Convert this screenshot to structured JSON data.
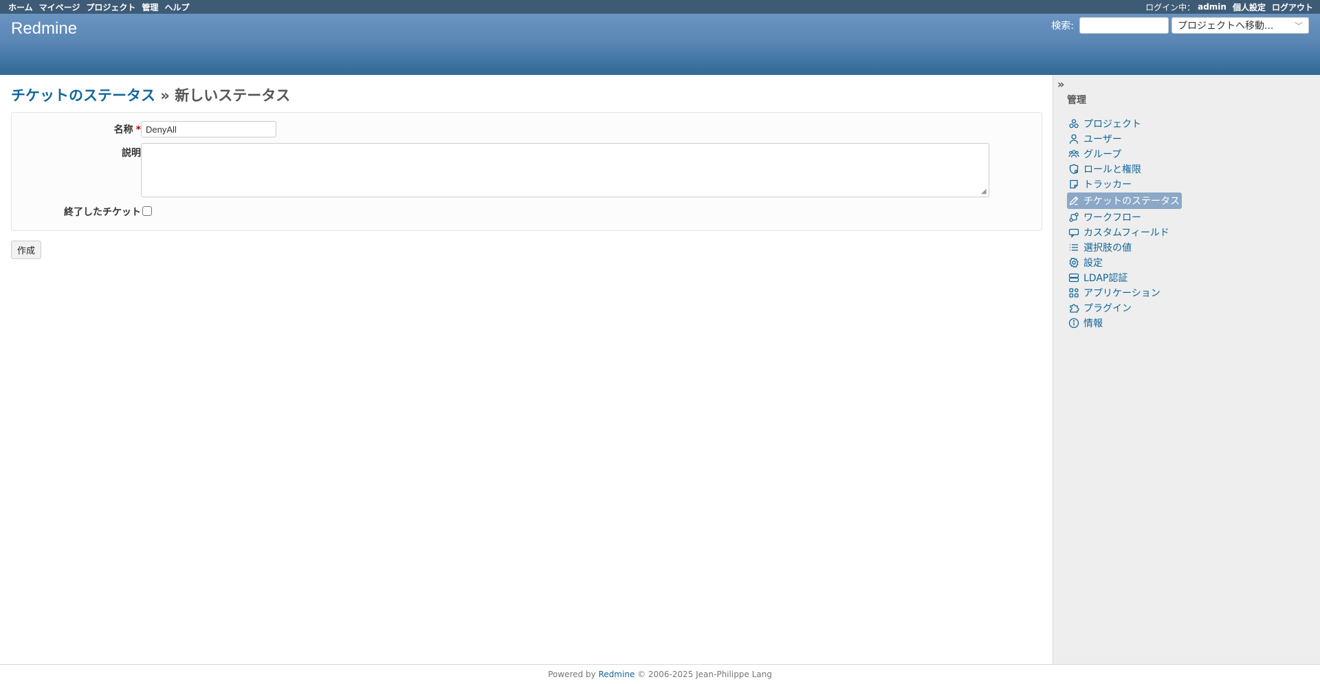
{
  "top_menu": {
    "items": [
      "ホーム",
      "マイページ",
      "プロジェクト",
      "管理",
      "ヘルプ"
    ],
    "logged_in_label": "ログイン中：",
    "user": "admin",
    "my_account": "個人設定",
    "logout": "ログアウト"
  },
  "header": {
    "title": "Redmine",
    "search_label": "検索:",
    "search_value": "",
    "jump_label": "プロジェクトへ移動..."
  },
  "page": {
    "breadcrumb_link": "チケットのステータス",
    "breadcrumb_sep": " » ",
    "breadcrumb_current": "新しいステータス"
  },
  "form": {
    "name_label": "名称",
    "required_mark": "*",
    "name_value": "DenyAll",
    "description_label": "説明",
    "description_value": "",
    "closed_label": "終了したチケット",
    "closed_checked": false,
    "submit_label": "作成"
  },
  "sidebar": {
    "title": "管理",
    "items": [
      {
        "label": "プロジェクト",
        "icon": "projects-icon"
      },
      {
        "label": "ユーザー",
        "icon": "user-icon"
      },
      {
        "label": "グループ",
        "icon": "group-icon"
      },
      {
        "label": "ロールと権限",
        "icon": "roles-icon"
      },
      {
        "label": "トラッカー",
        "icon": "tracker-icon"
      },
      {
        "label": "チケットのステータス",
        "icon": "issue-status-icon",
        "selected": true
      },
      {
        "label": "ワークフロー",
        "icon": "workflow-icon"
      },
      {
        "label": "カスタムフィールド",
        "icon": "custom-field-icon"
      },
      {
        "label": "選択肢の値",
        "icon": "list-icon"
      },
      {
        "label": "設定",
        "icon": "gear-icon"
      },
      {
        "label": "LDAP認証",
        "icon": "server-icon"
      },
      {
        "label": "アプリケーション",
        "icon": "apps-icon"
      },
      {
        "label": "プラグイン",
        "icon": "plugin-icon"
      },
      {
        "label": "情報",
        "icon": "info-icon"
      }
    ]
  },
  "footer": {
    "prefix": "Powered by ",
    "link": "Redmine",
    "suffix": " © 2006-2025 Jean-Philippe Lang"
  },
  "colors": {
    "top_menu_bg": "#3e5b76",
    "header_bg": "#628db6",
    "link": "#169",
    "selected_bg": "#8ba8c7"
  }
}
